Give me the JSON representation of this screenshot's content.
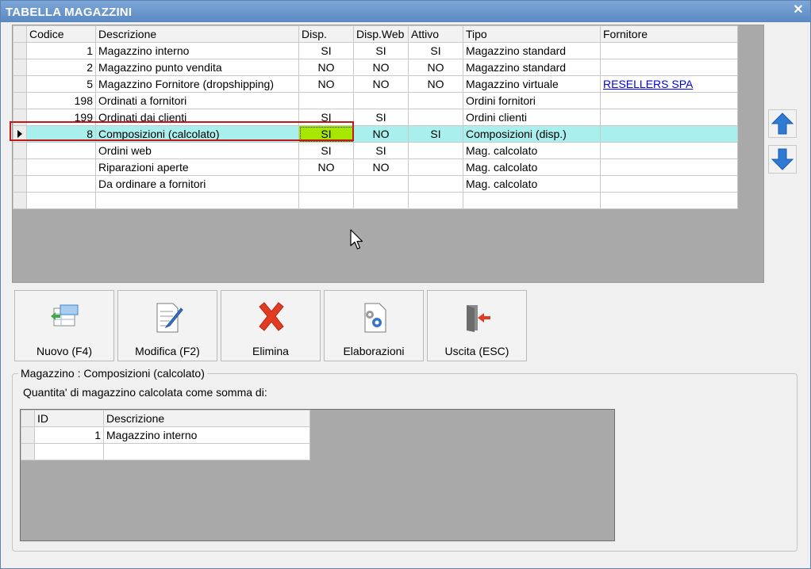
{
  "window": {
    "title": "TABELLA MAGAZZINI",
    "close_glyph": "✕"
  },
  "grid": {
    "headers": [
      "Codice",
      "Descrizione",
      "Disp.",
      "Disp.Web",
      "Attivo",
      "Tipo",
      "Fornitore"
    ],
    "rows": [
      {
        "codice": "1",
        "descrizione": "Magazzino interno",
        "disp": "SI",
        "disp_web": "SI",
        "attivo": "SI",
        "tipo": "Magazzino standard",
        "fornitore": ""
      },
      {
        "codice": "2",
        "descrizione": "Magazzino punto vendita",
        "disp": "NO",
        "disp_web": "NO",
        "attivo": "NO",
        "tipo": "Magazzino standard",
        "fornitore": ""
      },
      {
        "codice": "5",
        "descrizione": "Magazzino Fornitore (dropshipping)",
        "disp": "NO",
        "disp_web": "NO",
        "attivo": "NO",
        "tipo": "Magazzino virtuale",
        "fornitore": "RESELLERS SPA"
      },
      {
        "codice": "198",
        "descrizione": "Ordinati a fornitori",
        "disp": "",
        "disp_web": "",
        "attivo": "",
        "tipo": "Ordini fornitori",
        "fornitore": ""
      },
      {
        "codice": "199",
        "descrizione": "Ordinati dai clienti",
        "disp": "SI",
        "disp_web": "SI",
        "attivo": "",
        "tipo": "Ordini clienti",
        "fornitore": ""
      },
      {
        "codice": "8",
        "descrizione": "Composizioni (calcolato)",
        "disp": "SI",
        "disp_web": "NO",
        "attivo": "SI",
        "tipo": "Composizioni (disp.)",
        "fornitore": ""
      },
      {
        "codice": "",
        "descrizione": "Ordini web",
        "disp": "SI",
        "disp_web": "SI",
        "attivo": "",
        "tipo": "Mag. calcolato",
        "fornitore": ""
      },
      {
        "codice": "",
        "descrizione": "Riparazioni aperte",
        "disp": "NO",
        "disp_web": "NO",
        "attivo": "",
        "tipo": "Mag. calcolato",
        "fornitore": ""
      },
      {
        "codice": "",
        "descrizione": "Da ordinare a fornitori",
        "disp": "",
        "disp_web": "",
        "attivo": "",
        "tipo": "Mag. calcolato",
        "fornitore": ""
      }
    ],
    "selected_index": 5
  },
  "side_buttons": {
    "up_icon": "arrow-up-icon",
    "down_icon": "arrow-down-icon"
  },
  "toolbar": {
    "new_label": "Nuovo (F4)",
    "edit_label": "Modifica (F2)",
    "delete_label": "Elimina",
    "process_label": "Elaborazioni",
    "exit_label": "Uscita (ESC)"
  },
  "details": {
    "group_title": "Magazzino : Composizioni (calcolato)",
    "sum_label": "Quantita' di magazzino calcolata come somma di:",
    "headers": [
      "ID",
      "Descrizione"
    ],
    "rows": [
      {
        "id": "1",
        "descrizione": "Magazzino interno"
      }
    ]
  },
  "colors": {
    "titlebar": "#6a96cc",
    "selected_row": "#a9efee",
    "highlight_cell": "#a6e600",
    "arrow_blue": "#2f7ad2",
    "delete_red": "#e23b23"
  }
}
